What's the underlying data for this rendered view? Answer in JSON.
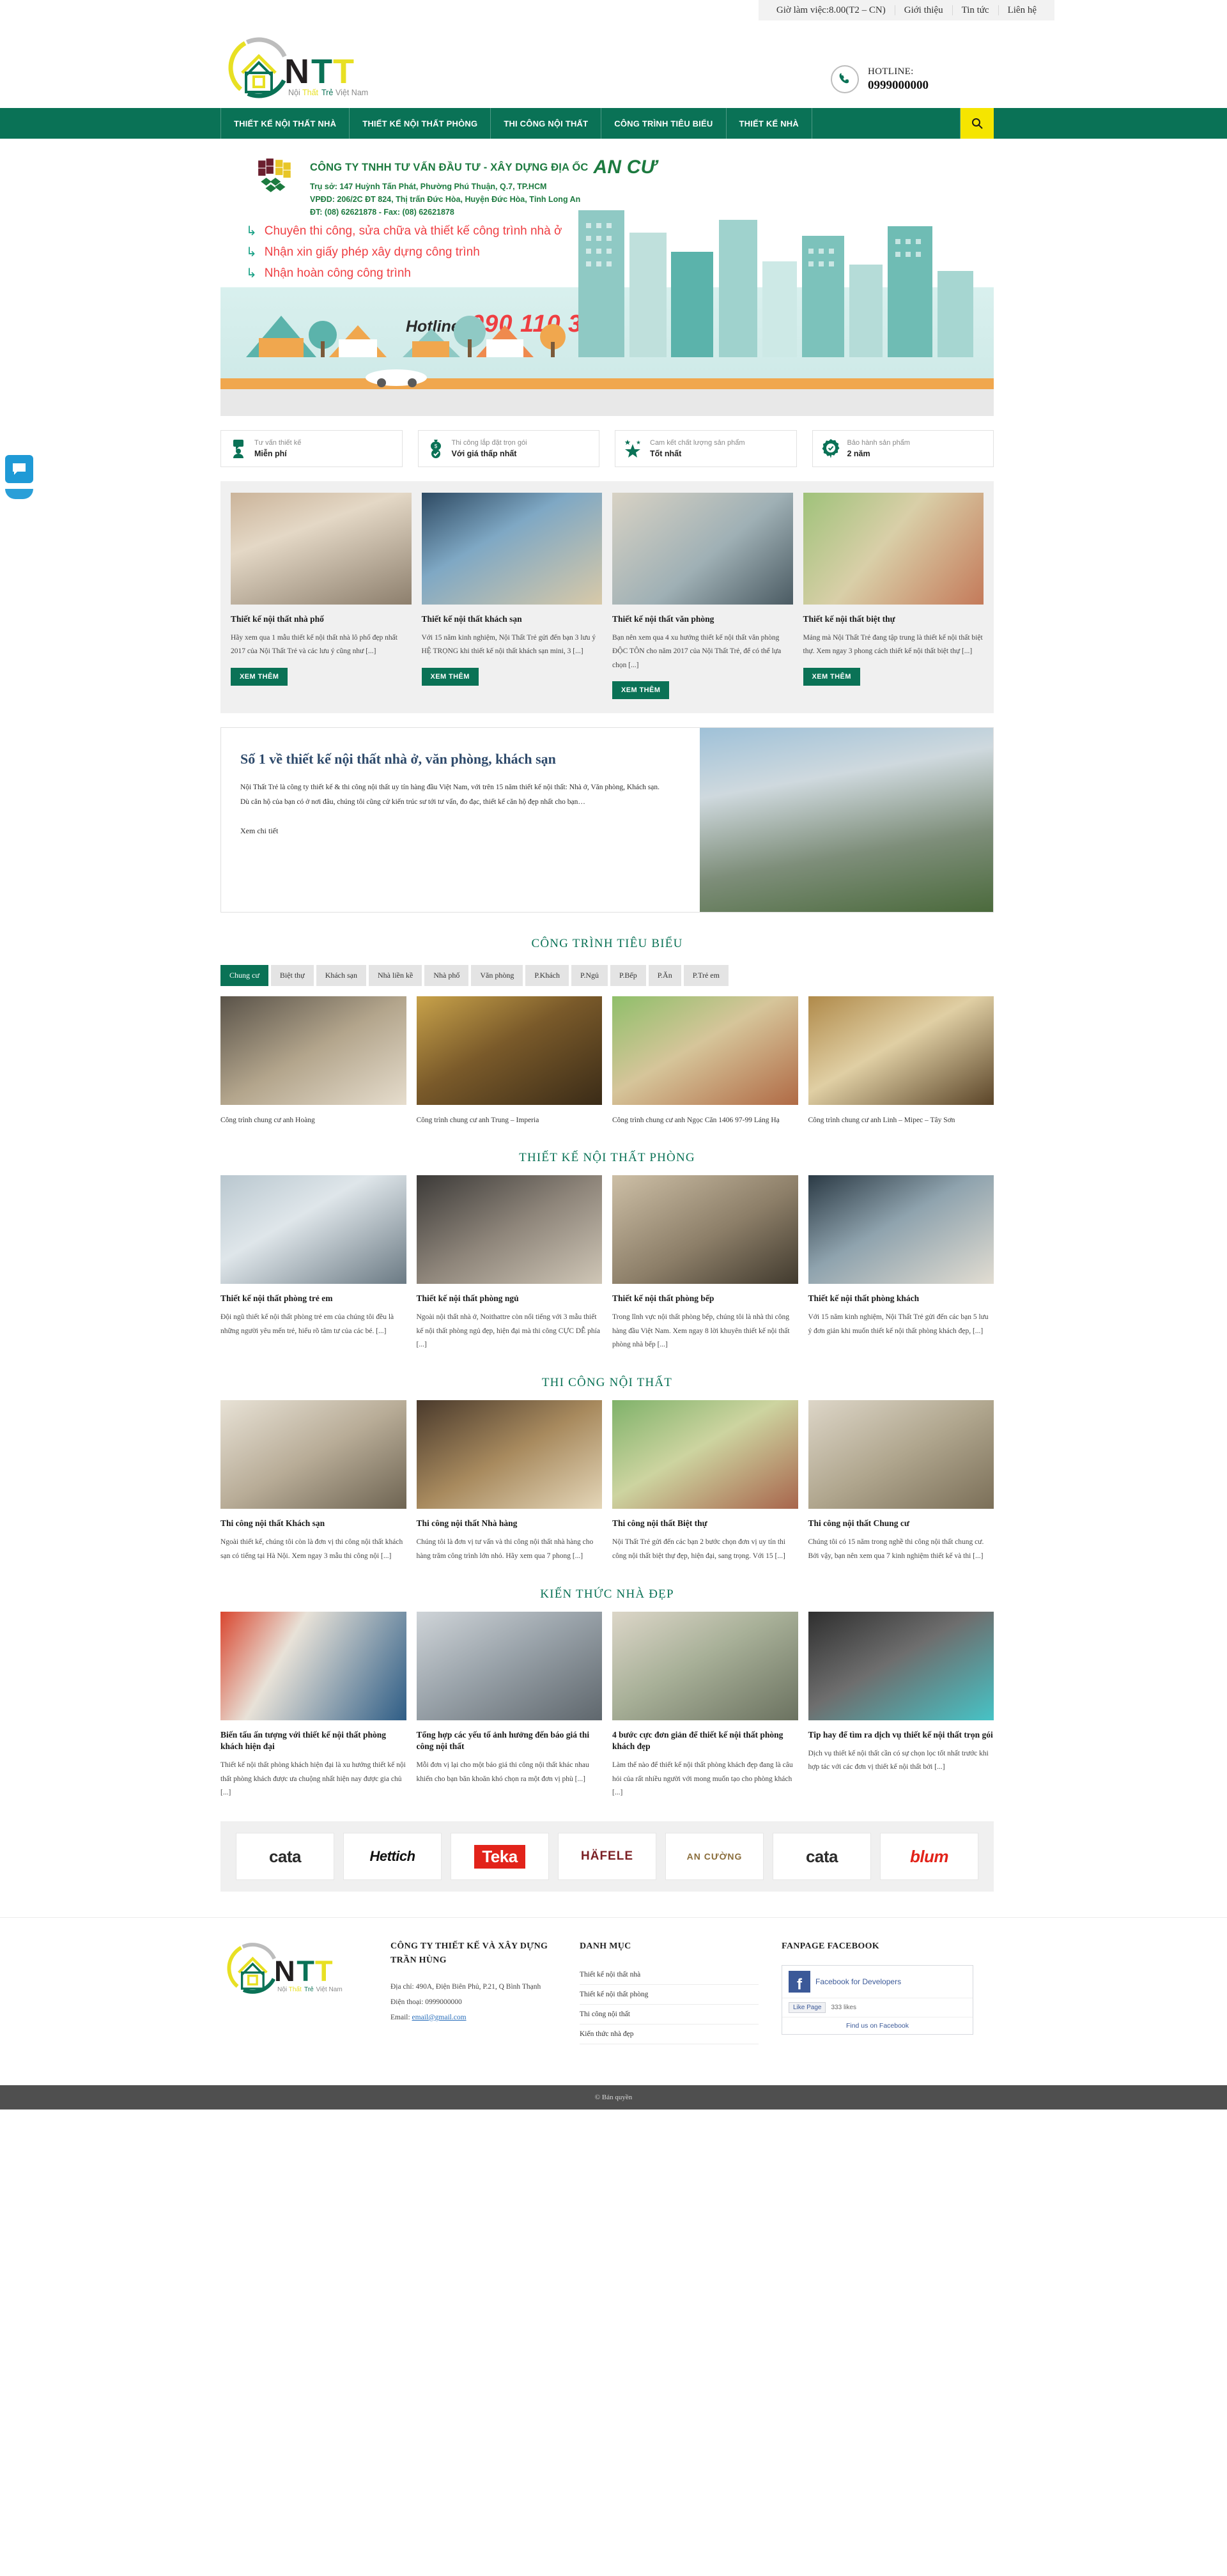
{
  "topbar": {
    "items": [
      "Giờ làm việc:8.00(T2 – CN)",
      "Giới thiệu",
      "Tin tức",
      "Liên hệ"
    ]
  },
  "header": {
    "logo_text": "NTT",
    "logo_tagline": "Nội Thất Trẻ Việt Nam",
    "hotline_label": "HOTLINE:",
    "hotline_number": "0999000000",
    "phone_icon": "phone-icon"
  },
  "nav": {
    "items": [
      "THIẾT KẾ NỘI THẤT NHÀ",
      "THIẾT KẾ NỘI THẤT PHÒNG",
      "THI CÔNG NỘI THẤT",
      "CÔNG TRÌNH TIÊU BIỂU",
      "THIẾT KẾ NHÀ"
    ],
    "search_icon": "search-icon"
  },
  "banner": {
    "company_title": "CÔNG TY TNHH TƯ VẤN ĐẦU TƯ - XÂY DỰNG ĐỊA ỐC",
    "company_brand": "AN CƯ",
    "address_lines": [
      "Trụ sở:   147 Huỳnh Tấn Phát, Phường Phú Thuận, Q.7, TP.HCM",
      "VPĐD: 206/2C ĐT 824, Thị trấn Đức Hòa, Huyện Đức Hòa, Tỉnh Long An",
      "ĐT: (08) 62621878  -  Fax: (08) 62621878"
    ],
    "bullets": [
      "Chuyên thi công, sửa chữa và thiết kế công trình nhà ở",
      "Nhận xin giấy phép xây dựng công trình",
      "Nhận hoàn công công trình"
    ],
    "hotline_label": "Hotline:",
    "hotline_number": "090 110 3399"
  },
  "features": [
    {
      "icon": "consult-icon",
      "sub": "Tư vấn thiết kế",
      "main": "Miễn phí"
    },
    {
      "icon": "money-bag-icon",
      "sub": "Thi công lắp đặt trọn gói",
      "main": "Với giá thấp nhất"
    },
    {
      "icon": "star-icon",
      "sub": "Cam kết chất lượng sản phẩm",
      "main": "Tốt nhất"
    },
    {
      "icon": "warranty-badge-icon",
      "sub": "Bảo hành sản phẩm",
      "main": "2 năm"
    }
  ],
  "top_cards": {
    "button_label": "XEM THÊM",
    "items": [
      {
        "title": "Thiết kế nội thất nhà phố",
        "desc": "Hãy xem qua 1 mẫu thiết kế nội thất nhà lô phố đẹp nhất 2017 của Nội Thất Trẻ và các lưu ý cũng như [...]"
      },
      {
        "title": "Thiết kế nội thất khách sạn",
        "desc": "Với 15 năm kinh nghiệm, Nội Thất Trẻ gửi đến bạn 3 lưu ý HỆ TRỌNG khi thiết kế nội thất khách sạn mini, 3 [...]"
      },
      {
        "title": "Thiết kế nội thất văn phòng",
        "desc": "Bạn nên xem qua 4 xu hướng thiết kế nội thất văn phòng ĐỘC TÔN cho năm 2017 của Nội Thất Trẻ, để có thể lựa chọn [...]"
      },
      {
        "title": "Thiết kế nội thất biệt thự",
        "desc": "Mảng mà Nội Thất Trẻ đang tập trung là thiết kế nội thất biệt thự. Xem ngay 3 phong cách thiết kế nội thất biệt thự [...]"
      }
    ]
  },
  "about": {
    "heading": "Số 1 về thiết kế nội thất nhà ở, văn phòng, khách sạn",
    "para1": "Nội Thất Trẻ là công ty thiết kế & thi công nội thất uy tín hàng đầu Việt Nam, với trên 15 năm thiết kế nội thất: Nhà ở, Văn phòng, Khách sạn.",
    "para2": "Dù căn hộ của bạn có ở nơi đâu, chúng tôi cũng cử kiến trúc sư tới tư vấn, đo đạc, thiết kế căn hộ đẹp nhất cho bạn…",
    "link": "Xem chi tiết"
  },
  "projects_section": {
    "heading": "CÔNG TRÌNH TIÊU BIỂU",
    "tabs": [
      "Chung cư",
      "Biệt thự",
      "Khách sạn",
      "Nhà liền kề",
      "Nhà phố",
      "Văn phòng",
      "P.Khách",
      "P.Ngủ",
      "P.Bếp",
      "P.Ăn",
      "P.Trẻ em"
    ],
    "active_tab": "Chung cư",
    "items": [
      {
        "caption": "Công trình chung cư anh Hoàng"
      },
      {
        "caption": "Công trình chung cư anh Trung – Imperia"
      },
      {
        "caption": "Công trình chung cư anh Ngọc Căn 1406 97-99 Láng Hạ"
      },
      {
        "caption": "Công trình chung cư anh Linh – Mipec – Tây Sơn"
      }
    ]
  },
  "room_section": {
    "heading": "THIẾT KẾ NỘI THẤT PHÒNG",
    "items": [
      {
        "title": "Thiết kế nội thất phòng trẻ em",
        "desc": "Đội ngũ thiết kế nội thất phòng trẻ em của chúng tôi đều là những người yêu mến trẻ, hiểu rõ tâm tư của các bé. [...]"
      },
      {
        "title": "Thiết kế nội thất phòng ngủ",
        "desc": "Ngoài nội thất nhà ở, Noithattre còn nổi tiếng với 3 mẫu thiết kế nội thất phòng ngủ đẹp, hiện đại mà thi công CỰC DỄ phía [...]"
      },
      {
        "title": "Thiết kế nội thất phòng bếp",
        "desc": "Trong lĩnh vực nội thất phòng bếp, chúng tôi là nhà thi công hàng đầu Việt Nam. Xem ngay 8 lời khuyên thiết kế nội thất phòng nhà bếp [...]"
      },
      {
        "title": "Thiết kế nội thất phòng khách",
        "desc": "Với 15 năm kinh nghiệm, Nội Thất Trẻ gửi đến các bạn 5 lưu ý đơn giản khi muốn thiết kế nội thất phòng khách đẹp, [...]"
      }
    ]
  },
  "construction_section": {
    "heading": "THI CÔNG NỘI THẤT",
    "items": [
      {
        "title": "Thi công nội thất Khách sạn",
        "desc": "Ngoài thiết kế, chúng tôi còn là đơn vị thi công nội thất khách sạn có tiếng tại Hà Nội. Xem ngay 3 mẫu thi công nội [...]"
      },
      {
        "title": "Thi công nội thất Nhà hàng",
        "desc": "Chúng tôi là đơn vị tư vấn và thi công nội thất nhà hàng cho hàng trăm công trình lớn nhỏ. Hãy xem qua 7 phong [...]"
      },
      {
        "title": "Thi công nội thất Biệt thự",
        "desc": "Nội Thất Trẻ gửi đến các bạn 2 bước chọn đơn vị uy tín thi công nội thất biệt thự đẹp, hiện đại, sang trọng. Với 15 [...]"
      },
      {
        "title": "Thi công nội thất Chung cư",
        "desc": "Chúng tôi có 15 năm trong nghề thi công nội thất chung cư. Bởi vậy, bạn nên xem qua 7 kinh nghiệm thiết kế và thi [...]"
      }
    ]
  },
  "knowledge_section": {
    "heading": "KIẾN THỨC NHÀ ĐẸP",
    "items": [
      {
        "title": "Biến tấu ấn tượng với thiết kế nội thất phòng khách hiện đại",
        "desc": "Thiết kế nội thất phòng khách hiện đại là xu hướng thiết kế nội thất phòng khách được ưa chuộng nhất hiện nay được gia chủ [...]"
      },
      {
        "title": "Tổng hợp các yếu tố ảnh hưởng đến báo giá thi công nội thất",
        "desc": "Mỗi đơn vị lại cho một báo giá thi công nội thất khác nhau khiến cho bạn băn khoăn khó chọn ra một đơn vị phù [...]"
      },
      {
        "title": "4 bước cực đơn giản để thiết kế nội thất phòng khách đẹp",
        "desc": "Làm thế nào để thiết kế nội thất phòng khách đẹp đang là câu hỏi của rất nhiều người với mong muốn tạo cho phòng khách [...]"
      },
      {
        "title": "Tip hay để tìm ra dịch vụ thiết kế nội thất trọn gói",
        "desc": "Dịch vụ thiết kế nội thất cần có sự chọn lọc tốt nhất trước khi hợp tác với các đơn vị thiết kế nội thất bởi [...]"
      }
    ]
  },
  "partners": [
    {
      "name": "cata",
      "color": "#2b2b2b"
    },
    {
      "name": "Hettich",
      "color": "#111111"
    },
    {
      "name": "Teka",
      "color": "#e2231a"
    },
    {
      "name": "HÄFELE",
      "color": "#7a1f23"
    },
    {
      "name": "AN CƯỜNG",
      "color": "#8a6d3b"
    },
    {
      "name": "cata",
      "color": "#2b2b2b"
    },
    {
      "name": "blum",
      "color": "#e2231a"
    }
  ],
  "footer": {
    "logo_text": "NTT",
    "logo_tagline": "Nội Thất Trẻ Việt Nam",
    "company_heading": "CÔNG TY THIẾT KẾ VÀ XÂY DỰNG TRẦN HÙNG",
    "address_label": "Địa chỉ: 490A, Điện Biên Phủ, P.21, Q Bình Thạnh",
    "phone_label": "Điện thoại: 0999000000",
    "email_label": "Email:",
    "email_value": "email@gmail.com",
    "menu_heading": "DANH MỤC",
    "menu_items": [
      "Thiết kế nội thất nhà",
      "Thiết kế nội thất phòng",
      "Thi công nội thất",
      "Kiến thức nhà đẹp"
    ],
    "fanpage_heading": "FANPAGE FACEBOOK",
    "fb_page_title": "Facebook for Developers",
    "fb_like_label": "Like Page",
    "fb_count_label": "333 likes",
    "fb_follow_label": "Find us on Facebook"
  },
  "copyright": "© Bản quyền",
  "chat_icon": "chat-bubble-icon"
}
